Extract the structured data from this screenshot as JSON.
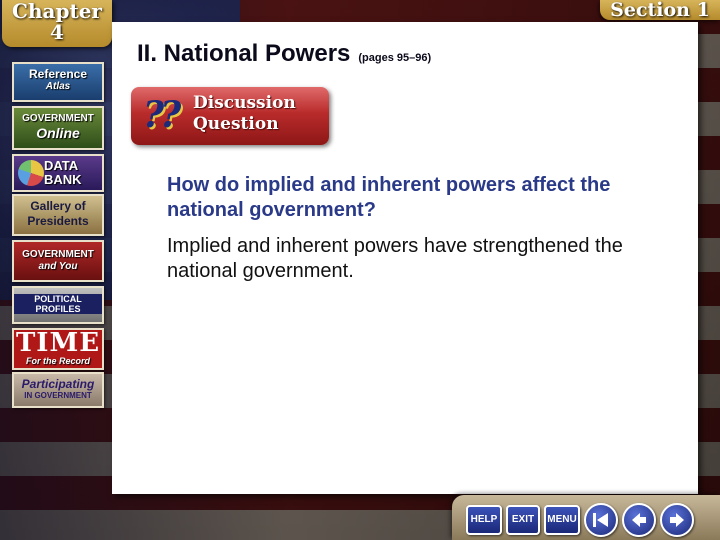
{
  "tabs": {
    "chapter_label": "Chapter",
    "chapter_number": "4",
    "section_label": "Section 1"
  },
  "slide": {
    "title": "II. National Powers",
    "pages": "(pages 95–96)",
    "badge_line1": "Discussion",
    "badge_line2": "Question",
    "badge_symbol": "??",
    "question": "How do implied and inherent powers affect the national government?",
    "answer": "Implied and inherent powers have strengthened the national government."
  },
  "sidebar": {
    "reference_atlas": {
      "line1": "Reference",
      "line2": "Atlas"
    },
    "government_online": {
      "line1": "GOVERNMENT",
      "line2": "Online"
    },
    "data_bank": {
      "line1": "DATA",
      "line2": "BANK"
    },
    "gallery_of_presidents": {
      "line1": "Gallery of",
      "line2": "Presidents"
    },
    "government_and_you": {
      "line1": "GOVERNMENT",
      "line2": "and You"
    },
    "political_profiles": {
      "line1": "POLITICAL",
      "line2": "PROFILES"
    },
    "time_for_the_record": {
      "line1": "TIME",
      "line2": "For the Record"
    },
    "participating": {
      "line1": "Participating",
      "line2": "IN GOVERNMENT"
    }
  },
  "navbar": {
    "help_label": "HELP",
    "exit_label": "EXIT",
    "menu_label": "MENU"
  },
  "colors": {
    "question_text": "#2a3a88",
    "badge_red": "#b92b2b",
    "tab_gold": "#c9a240",
    "nav_blue": "#1b2878"
  }
}
